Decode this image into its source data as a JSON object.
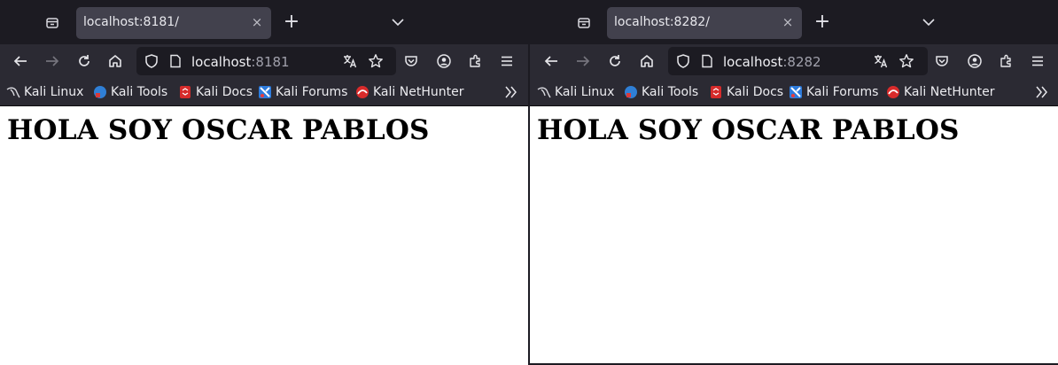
{
  "windows": [
    {
      "tab": {
        "title": "localhost:8181/",
        "close_label": "×"
      },
      "newtab_label": "+",
      "url": {
        "host": "localhost",
        "port": ":8181"
      },
      "bookmarks": [
        {
          "label": "Kali Linux",
          "icon": "kali-dragon-icon"
        },
        {
          "label": "Kali Tools",
          "icon": "kali-tools-icon"
        },
        {
          "label": "Kali Docs",
          "icon": "kali-docs-icon"
        },
        {
          "label": "Kali Forums",
          "icon": "kali-forums-icon"
        },
        {
          "label": "Kali NetHunter",
          "icon": "kali-nethunter-icon"
        }
      ],
      "page": {
        "heading": "HOLA SOY OSCAR PABLOS"
      }
    },
    {
      "tab": {
        "title": "localhost:8282/",
        "close_label": "×"
      },
      "newtab_label": "+",
      "url": {
        "host": "localhost",
        "port": ":8282"
      },
      "bookmarks": [
        {
          "label": "Kali Linux",
          "icon": "kali-dragon-icon"
        },
        {
          "label": "Kali Tools",
          "icon": "kali-tools-icon"
        },
        {
          "label": "Kali Docs",
          "icon": "kali-docs-icon"
        },
        {
          "label": "Kali Forums",
          "icon": "kali-forums-icon"
        },
        {
          "label": "Kali NetHunter",
          "icon": "kali-nethunter-icon"
        }
      ],
      "page": {
        "heading": "HOLA SOY OSCAR PABLOS"
      }
    }
  ],
  "colors": {
    "titlebar": "#1c1b22",
    "toolbar": "#2b2a33",
    "active_tab": "#42414d",
    "urlbar": "#1c1b22",
    "page_background": "#ffffff"
  }
}
